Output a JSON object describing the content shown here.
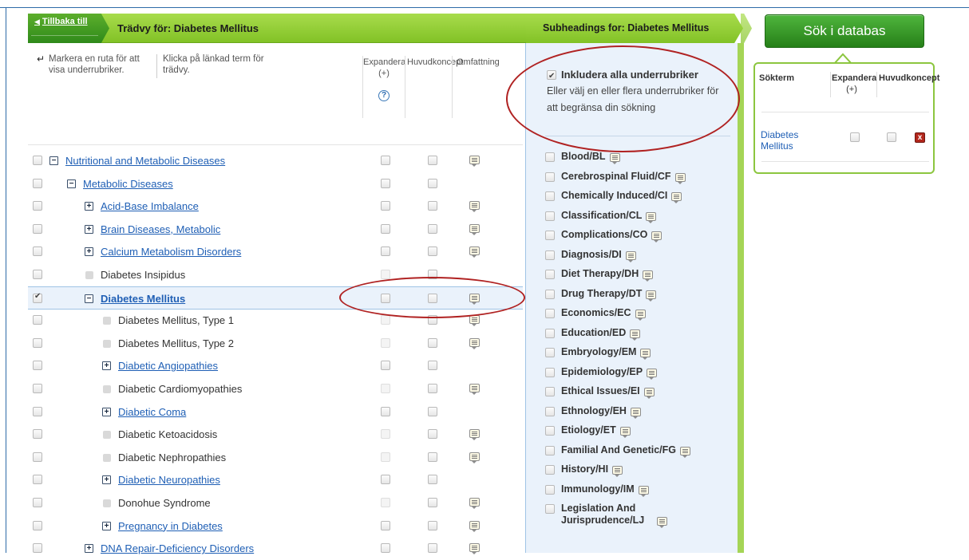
{
  "tree_header": {
    "back_label": "Tillbaka till",
    "title": "Trädvy för: Diabetes Mellitus"
  },
  "subheadings_header": {
    "title": "Subheadings for: Diabetes Mellitus"
  },
  "tree_instructions": {
    "mark_hint": "Markera en ruta för att visa underrubriker.",
    "click_hint": "Klicka på länkad term för trädvy."
  },
  "tree_columns": {
    "expand": "Expandera",
    "expand_sub": "(+)",
    "major": "Huvudkoncept",
    "scope": "Omfattning"
  },
  "tree_rows": [
    {
      "label": "Nutritional and Metabolic Diseases",
      "toggle": "−",
      "linked": true,
      "checked": false,
      "scope_note": true
    },
    {
      "label": "Metabolic Diseases",
      "toggle": "−",
      "linked": true,
      "checked": false,
      "scope_note": false
    },
    {
      "label": "Acid-Base Imbalance",
      "toggle": "+",
      "linked": true,
      "checked": false,
      "scope_note": true
    },
    {
      "label": "Brain Diseases, Metabolic",
      "toggle": "+",
      "linked": true,
      "checked": false,
      "scope_note": true
    },
    {
      "label": "Calcium Metabolism Disorders",
      "toggle": "+",
      "linked": true,
      "checked": false,
      "scope_note": true
    },
    {
      "label": "Diabetes Insipidus",
      "toggle": "",
      "linked": false,
      "checked": false,
      "scope_note": false
    },
    {
      "label": "Diabetes Mellitus",
      "toggle": "−",
      "linked": true,
      "checked": true,
      "selected": true,
      "scope_note": true
    },
    {
      "label": "Diabetes Mellitus, Type 1",
      "toggle": "",
      "linked": false,
      "checked": false,
      "scope_note": true
    },
    {
      "label": "Diabetes Mellitus, Type 2",
      "toggle": "",
      "linked": false,
      "checked": false,
      "scope_note": true
    },
    {
      "label": "Diabetic Angiopathies",
      "toggle": "+",
      "linked": true,
      "checked": false,
      "scope_note": false
    },
    {
      "label": "Diabetic Cardiomyopathies",
      "toggle": "",
      "linked": false,
      "checked": false,
      "scope_note": true
    },
    {
      "label": "Diabetic Coma",
      "toggle": "+",
      "linked": true,
      "checked": false,
      "scope_note": false
    },
    {
      "label": "Diabetic Ketoacidosis",
      "toggle": "",
      "linked": false,
      "checked": false,
      "scope_note": true
    },
    {
      "label": "Diabetic Nephropathies",
      "toggle": "",
      "linked": false,
      "checked": false,
      "scope_note": true
    },
    {
      "label": "Diabetic Neuropathies",
      "toggle": "+",
      "linked": true,
      "checked": false,
      "scope_note": false
    },
    {
      "label": "Donohue Syndrome",
      "toggle": "",
      "linked": false,
      "checked": false,
      "scope_note": true
    },
    {
      "label": "Pregnancy in Diabetes",
      "toggle": "+",
      "linked": true,
      "checked": false,
      "scope_note": true
    },
    {
      "label": "DNA Repair-Deficiency Disorders",
      "toggle": "+",
      "linked": true,
      "checked": false,
      "scope_note": true
    }
  ],
  "subheadings": {
    "include_all_label": "Inkludera alla underrubriker",
    "include_all_checked": true,
    "include_all_desc": "Eller välj en eller flera underrubriker för att begränsa din sökning",
    "items": [
      "Blood/BL",
      "Cerebrospinal Fluid/CF",
      "Chemically Induced/CI",
      "Classification/CL",
      "Complications/CO",
      "Diagnosis/DI",
      "Diet Therapy/DH",
      "Drug Therapy/DT",
      "Economics/EC",
      "Education/ED",
      "Embryology/EM",
      "Epidemiology/EP",
      "Ethical Issues/EI",
      "Ethnology/EH",
      "Etiology/ET",
      "Familial And Genetic/FG",
      "History/HI",
      "Immunology/IM",
      "Legislation And Jurisprudence/LJ"
    ]
  },
  "search": {
    "button_label": "Sök i databas",
    "col_term": "Sökterm",
    "col_expand": "Expandera",
    "col_expand_sub": "(+)",
    "col_major": "Huvudkoncept",
    "term": "Diabetes Mellitus",
    "delete_symbol": "x"
  },
  "colors": {
    "banner_green": "#94cf3a",
    "link_blue": "#1f5fb5",
    "panel_blue": "#eaf2fb",
    "callout_red": "#b02222",
    "delete_red": "#b3271c"
  }
}
